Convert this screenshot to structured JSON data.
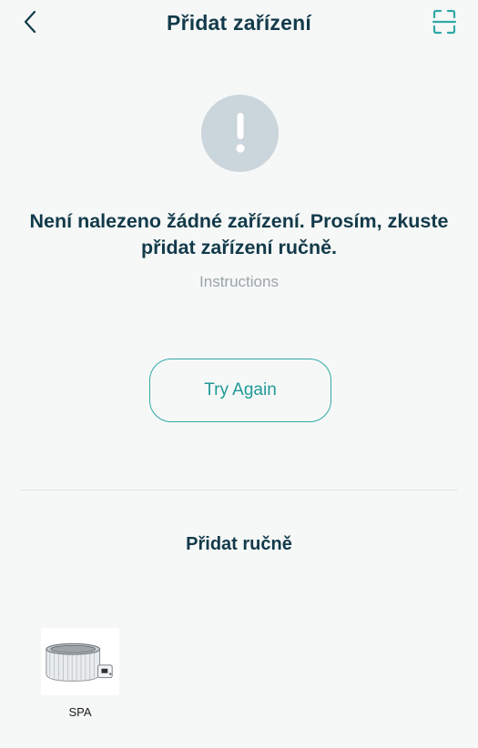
{
  "header": {
    "title": "Přidat zařízení",
    "back_icon": "chevron-left-icon",
    "scan_icon": "scan-frame-icon"
  },
  "status": {
    "icon": "exclamation-icon",
    "message": "Není nalezeno žádné zařízení. Prosím, zkuste přidat zařízení ručně.",
    "instructions_link": "Instructions",
    "retry_button": "Try Again"
  },
  "manual": {
    "section_title": "Přidat ručně",
    "devices": [
      {
        "label": "SPA",
        "icon": "hot-tub-icon"
      }
    ]
  },
  "colors": {
    "title_text": "#123a4a",
    "accent": "#2fa9a6",
    "alert_circle": "#cbd5dc",
    "muted_text": "#9aa4a9",
    "background": "#f6f8f7"
  }
}
